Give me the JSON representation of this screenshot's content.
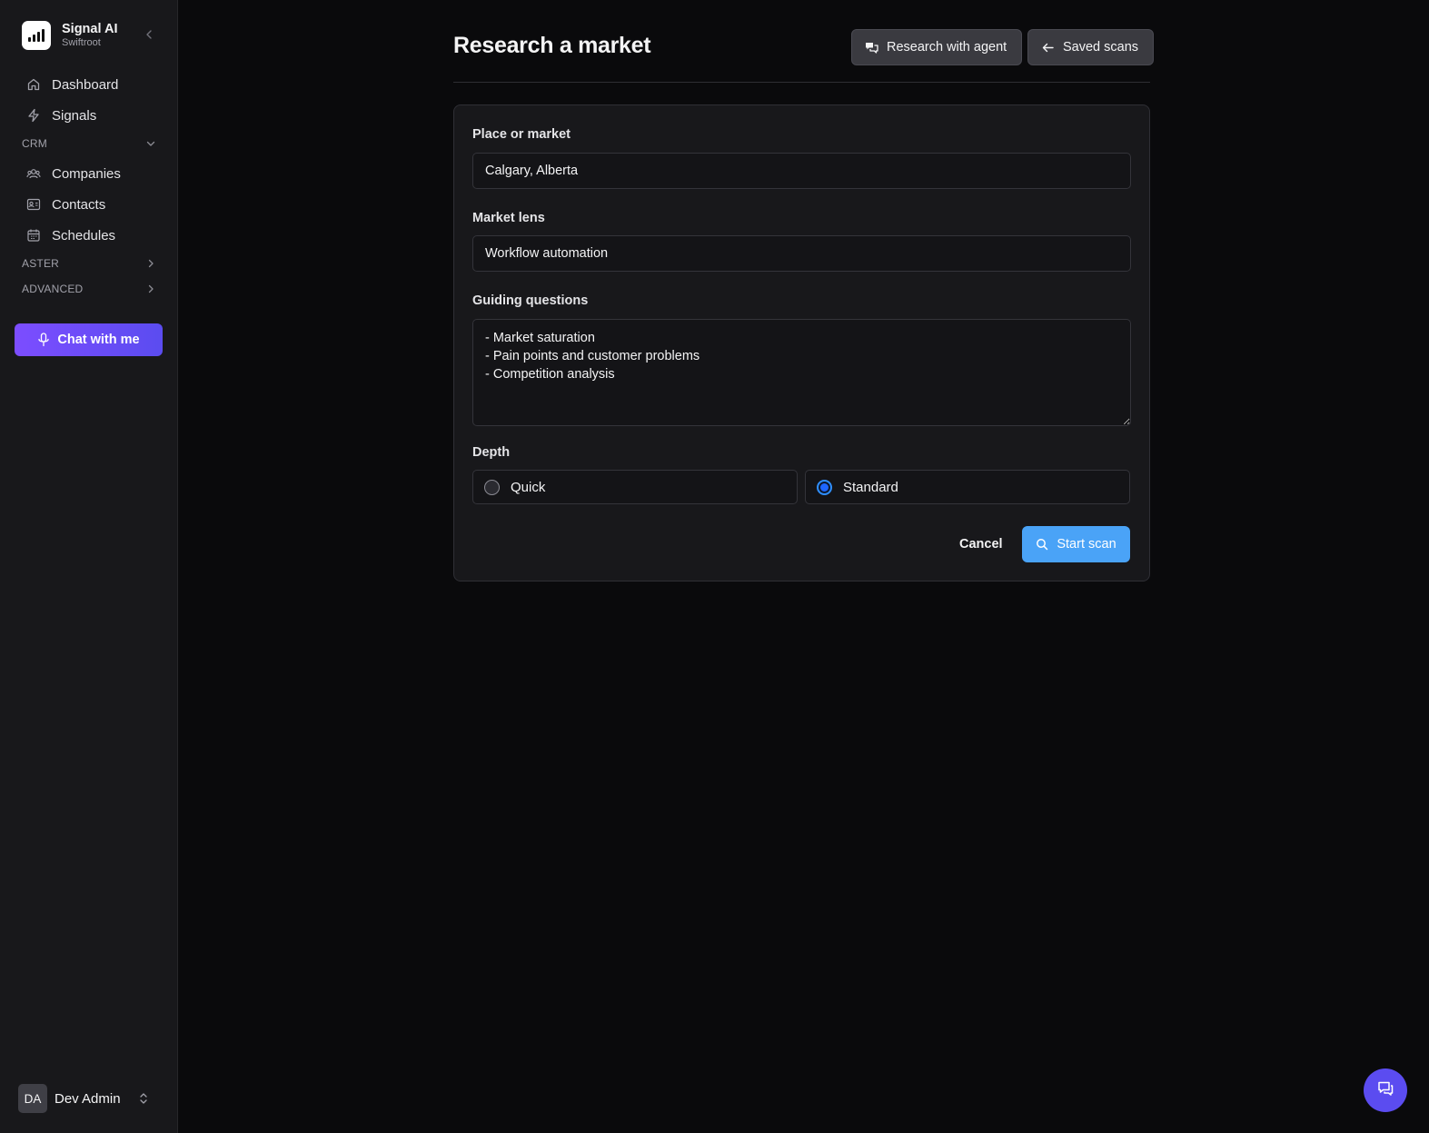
{
  "brand": {
    "title": "Signal AI",
    "subtitle": "Swiftroot"
  },
  "sidebar": {
    "items": [
      {
        "label": "Dashboard",
        "icon": "home-icon"
      },
      {
        "label": "Signals",
        "icon": "bolt-icon"
      }
    ],
    "crm": {
      "label": "CRM",
      "items": [
        {
          "label": "Companies",
          "icon": "companies-icon"
        },
        {
          "label": "Contacts",
          "icon": "contact-card-icon"
        },
        {
          "label": "Schedules",
          "icon": "calendar-icon"
        }
      ]
    },
    "sections": [
      {
        "label": "ASTER"
      },
      {
        "label": "ADVANCED"
      }
    ],
    "chat_button": "Chat with me"
  },
  "user": {
    "initials": "DA",
    "name": "Dev Admin"
  },
  "header": {
    "title": "Research a market",
    "research_agent_label": "Research with agent",
    "saved_scans_label": "Saved scans"
  },
  "form": {
    "place": {
      "label": "Place or market",
      "value": "Calgary, Alberta"
    },
    "lens": {
      "label": "Market lens",
      "value": "Workflow automation"
    },
    "questions": {
      "label": "Guiding questions",
      "value": "- Market saturation\n- Pain points and customer problems\n- Competition analysis"
    },
    "depth": {
      "label": "Depth",
      "options": [
        {
          "label": "Quick",
          "selected": false
        },
        {
          "label": "Standard",
          "selected": true
        }
      ]
    },
    "cancel_label": "Cancel",
    "start_label": "Start scan"
  },
  "colors": {
    "accent_purple": "#5b4cf0",
    "primary_blue": "#4aa3f7",
    "radio_selected": "#1e66ff",
    "background": "#0a0a0c",
    "sidebar_bg": "#18181b"
  }
}
